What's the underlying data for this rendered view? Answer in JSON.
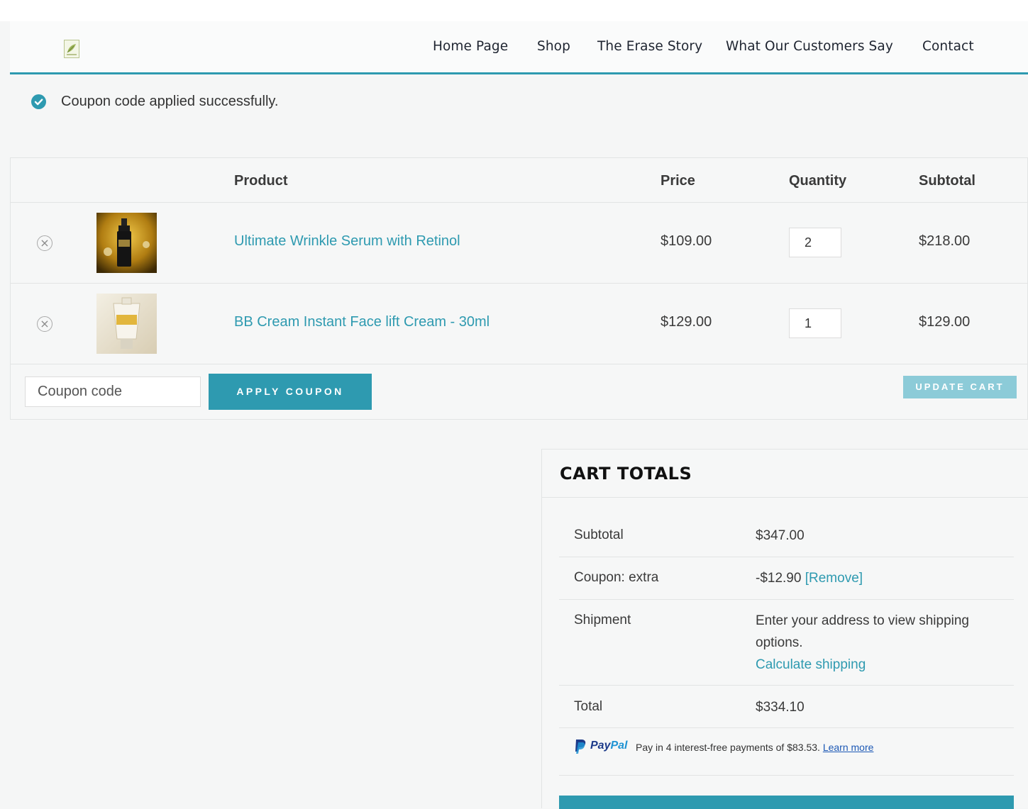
{
  "nav": {
    "items": [
      {
        "label": "Home Page"
      },
      {
        "label": "Shop"
      },
      {
        "label": "The Erase Story"
      },
      {
        "label": "What Our Customers Say"
      },
      {
        "label": "Contact"
      }
    ]
  },
  "notice": {
    "message": "Coupon code applied successfully."
  },
  "cart": {
    "headers": {
      "product": "Product",
      "price": "Price",
      "quantity": "Quantity",
      "subtotal": "Subtotal"
    },
    "rows": [
      {
        "name": "Ultimate Wrinkle Serum with Retinol",
        "price": "$109.00",
        "quantity": "2",
        "subtotal": "$218.00"
      },
      {
        "name": "BB Cream Instant Face lift Cream - 30ml",
        "price": "$129.00",
        "quantity": "1",
        "subtotal": "$129.00"
      }
    ],
    "coupon_placeholder": "Coupon code",
    "apply_label": "APPLY COUPON",
    "update_label": "UPDATE CART"
  },
  "totals": {
    "title": "CART TOTALS",
    "subtotal_label": "Subtotal",
    "subtotal_value": "$347.00",
    "coupon_label": "Coupon: extra",
    "coupon_value": "-$12.90",
    "coupon_remove": "[Remove]",
    "shipment_label": "Shipment",
    "shipment_text_1": "Enter your address to view shipping",
    "shipment_text_2": "options.",
    "shipment_link": "Calculate shipping",
    "total_label": "Total",
    "total_value": "$334.10"
  },
  "paypal": {
    "brand_1": "Pay",
    "brand_2": "Pal",
    "text": "Pay in 4 interest-free payments of $83.53.",
    "link": "Learn more"
  },
  "colors": {
    "accent": "#2e9ab0",
    "update_button": "#8ccbd8",
    "paypal_dark": "#1d3b8a",
    "paypal_light": "#1f93d3"
  }
}
